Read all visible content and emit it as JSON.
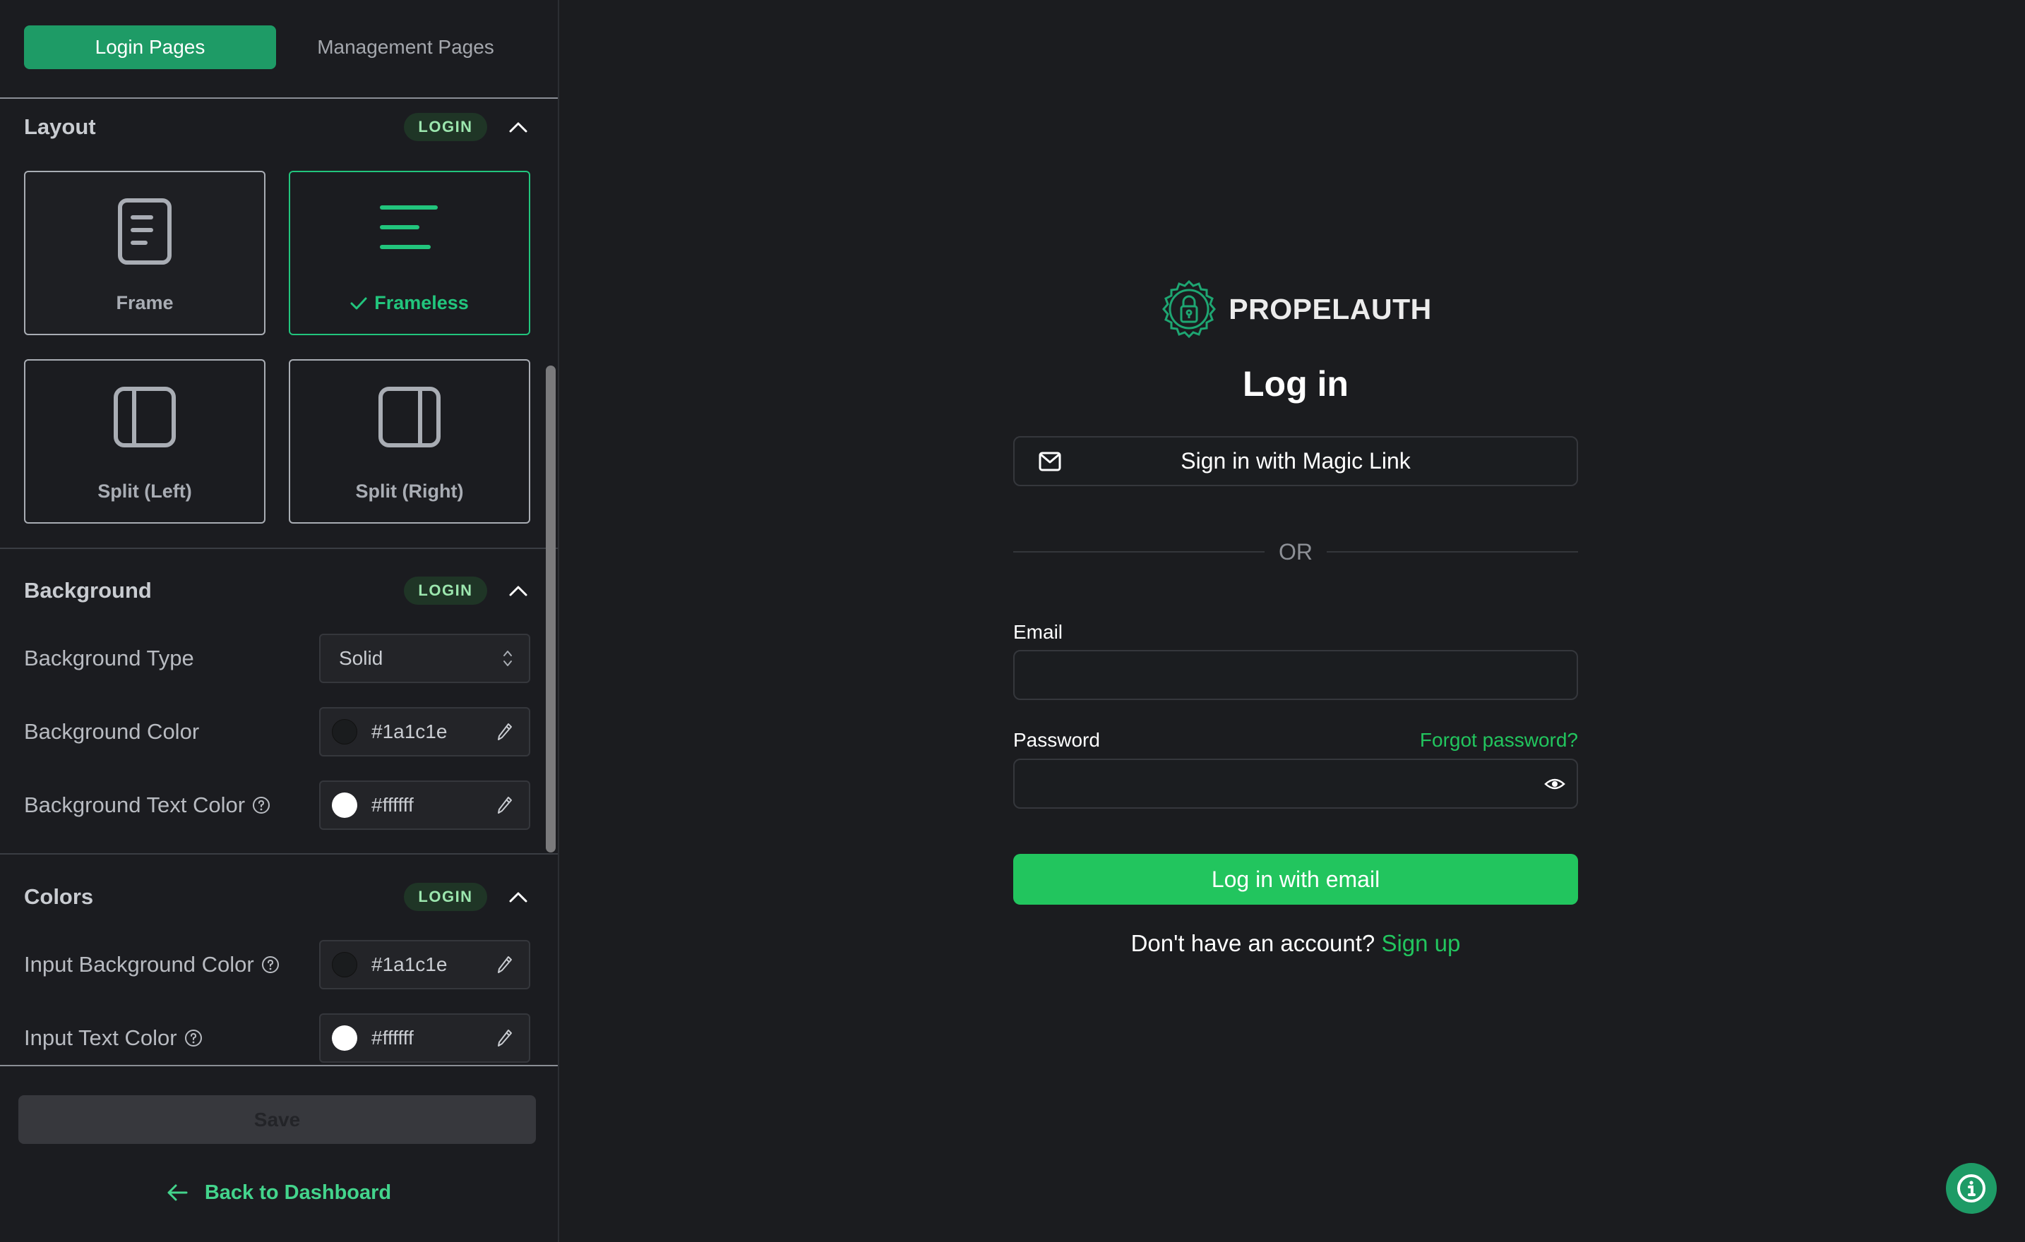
{
  "sidebar": {
    "tabs": [
      {
        "label": "Login Pages",
        "active": true
      },
      {
        "label": "Management Pages",
        "active": false
      }
    ],
    "sections": {
      "layout": {
        "title": "Layout",
        "badge": "LOGIN",
        "options": [
          {
            "label": "Frame",
            "icon": "frame-layout-icon",
            "selected": false
          },
          {
            "label": "Frameless",
            "icon": "frameless-layout-icon",
            "selected": true
          },
          {
            "label": "Split (Left)",
            "icon": "split-left-layout-icon",
            "selected": false
          },
          {
            "label": "Split (Right)",
            "icon": "split-right-layout-icon",
            "selected": false
          }
        ]
      },
      "background": {
        "title": "Background",
        "badge": "LOGIN",
        "rows": [
          {
            "label": "Background Type",
            "value": "Solid",
            "type": "select"
          },
          {
            "label": "Background Color",
            "value": "#1a1c1e",
            "swatch": "#1a1c1e",
            "help": false
          },
          {
            "label": "Background Text Color",
            "value": "#ffffff",
            "swatch": "#ffffff",
            "help": true
          }
        ]
      },
      "colors": {
        "title": "Colors",
        "badge": "LOGIN",
        "rows": [
          {
            "label": "Input Background Color",
            "value": "#1a1c1e",
            "swatch": "#1a1c1e",
            "help": true
          },
          {
            "label": "Input Text Color",
            "value": "#ffffff",
            "swatch": "#ffffff",
            "help": true
          }
        ]
      }
    },
    "save_label": "Save",
    "back_label": "Back to Dashboard"
  },
  "login": {
    "brand_name": "PROPELAUTH",
    "title": "Log in",
    "magic_link_label": "Sign in with Magic Link",
    "divider_text": "OR",
    "email_label": "Email",
    "email_value": "",
    "password_label": "Password",
    "password_value": "",
    "forgot_label": "Forgot password?",
    "submit_label": "Log in with email",
    "signup_prompt": "Don't have an account?",
    "signup_link": "Sign up"
  },
  "colors": {
    "accent": "#1e9b66",
    "brand_green": "#22c55e",
    "badge_text": "#9ce6ae",
    "background": "#1a1c1e"
  }
}
